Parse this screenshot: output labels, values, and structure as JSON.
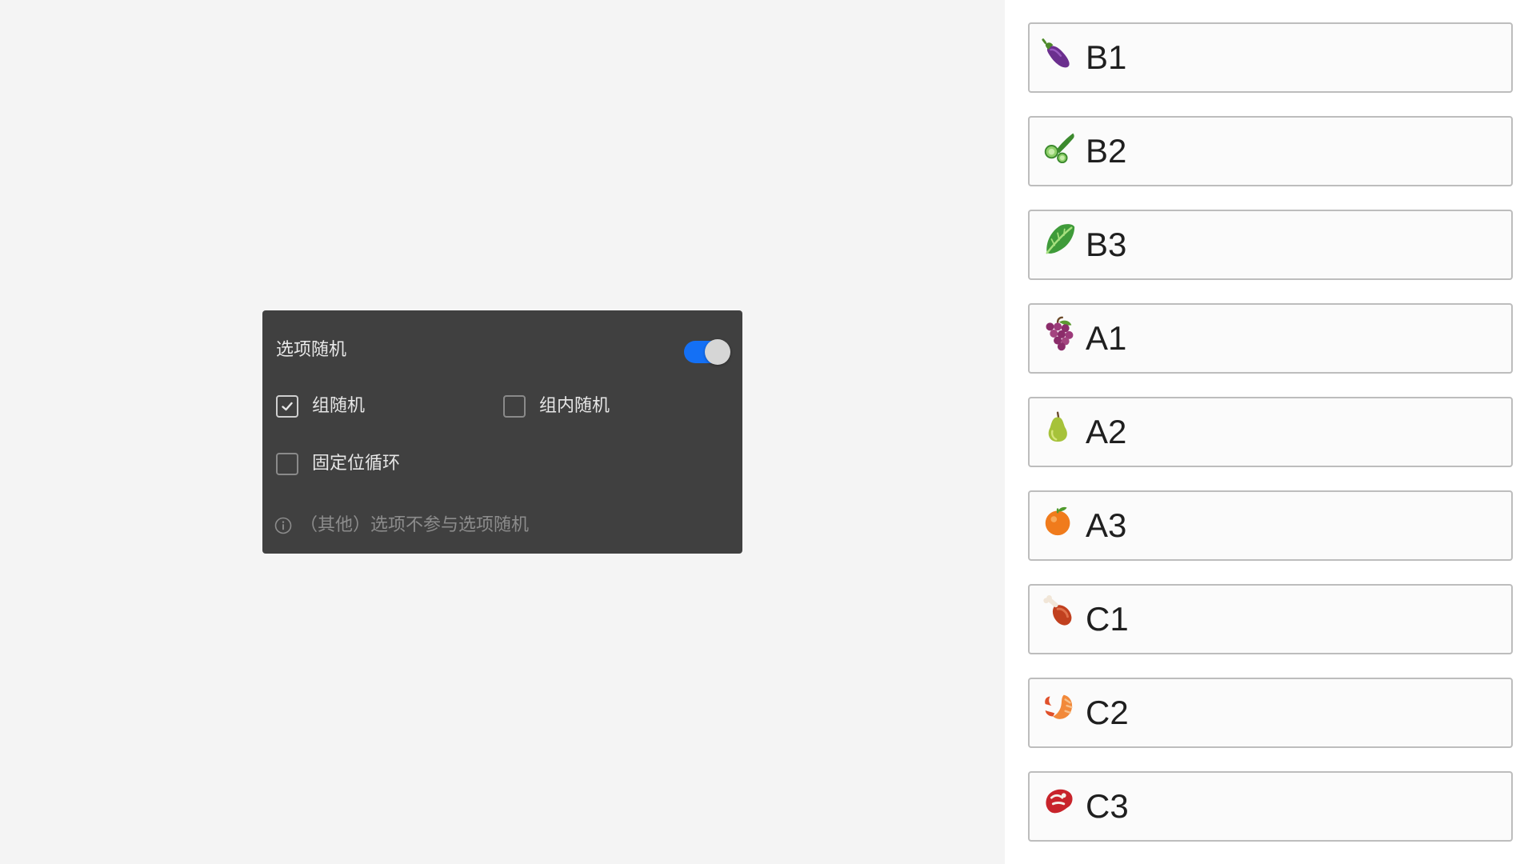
{
  "panel": {
    "title": "选项随机",
    "toggle_on": true,
    "accent_color": "#1470f5",
    "options": [
      {
        "label": "组随机",
        "checked": true
      },
      {
        "label": "组内随机",
        "checked": false
      },
      {
        "label": "固定位循环",
        "checked": false
      }
    ],
    "hint": "（其他）选项不参与选项随机",
    "hint_icon": "info-icon"
  },
  "items": [
    {
      "icon": "eggplant-icon",
      "label": "B1"
    },
    {
      "icon": "cucumber-icon",
      "label": "B2"
    },
    {
      "icon": "leafy-green-icon",
      "label": "B3"
    },
    {
      "icon": "grapes-icon",
      "label": "A1"
    },
    {
      "icon": "pear-icon",
      "label": "A2"
    },
    {
      "icon": "tangerine-icon",
      "label": "A3"
    },
    {
      "icon": "meat-on-bone-icon",
      "label": "C1"
    },
    {
      "icon": "shrimp-icon",
      "label": "C2"
    },
    {
      "icon": "steak-icon",
      "label": "C3"
    }
  ]
}
